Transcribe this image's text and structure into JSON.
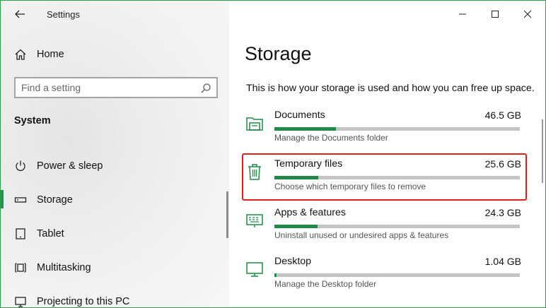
{
  "app": {
    "title": "Settings"
  },
  "search": {
    "placeholder": "Find a setting"
  },
  "sidebar": {
    "home_label": "Home",
    "section": "System",
    "items": [
      {
        "label": "Power & sleep",
        "icon": "power-icon"
      },
      {
        "label": "Storage",
        "icon": "storage-icon",
        "active": true
      },
      {
        "label": "Tablet",
        "icon": "tablet-icon"
      },
      {
        "label": "Multitasking",
        "icon": "multitasking-icon"
      },
      {
        "label": "Projecting to this PC",
        "icon": "projecting-icon"
      }
    ]
  },
  "main": {
    "title": "Storage",
    "subtitle": "This is how your storage is used and how you can free up space.",
    "items": [
      {
        "name": "Documents",
        "size": "46.5 GB",
        "desc": "Manage the Documents folder",
        "usage": 0.25,
        "icon": "documents-folder-icon"
      },
      {
        "name": "Temporary files",
        "size": "25.6 GB",
        "desc": "Choose which temporary files to remove",
        "usage": 0.18,
        "icon": "trash-icon",
        "highlighted": true
      },
      {
        "name": "Apps & features",
        "size": "24.3 GB",
        "desc": "Uninstall unused or undesired apps & features",
        "usage": 0.175,
        "icon": "apps-features-icon"
      },
      {
        "name": "Desktop",
        "size": "1.04 GB",
        "desc": "Manage the Desktop folder",
        "usage": 0.01,
        "icon": "desktop-monitor-icon"
      }
    ]
  },
  "colors": {
    "accent": "#1f8a45",
    "highlight": "#e02020",
    "bar_track": "#c4c4c4"
  }
}
